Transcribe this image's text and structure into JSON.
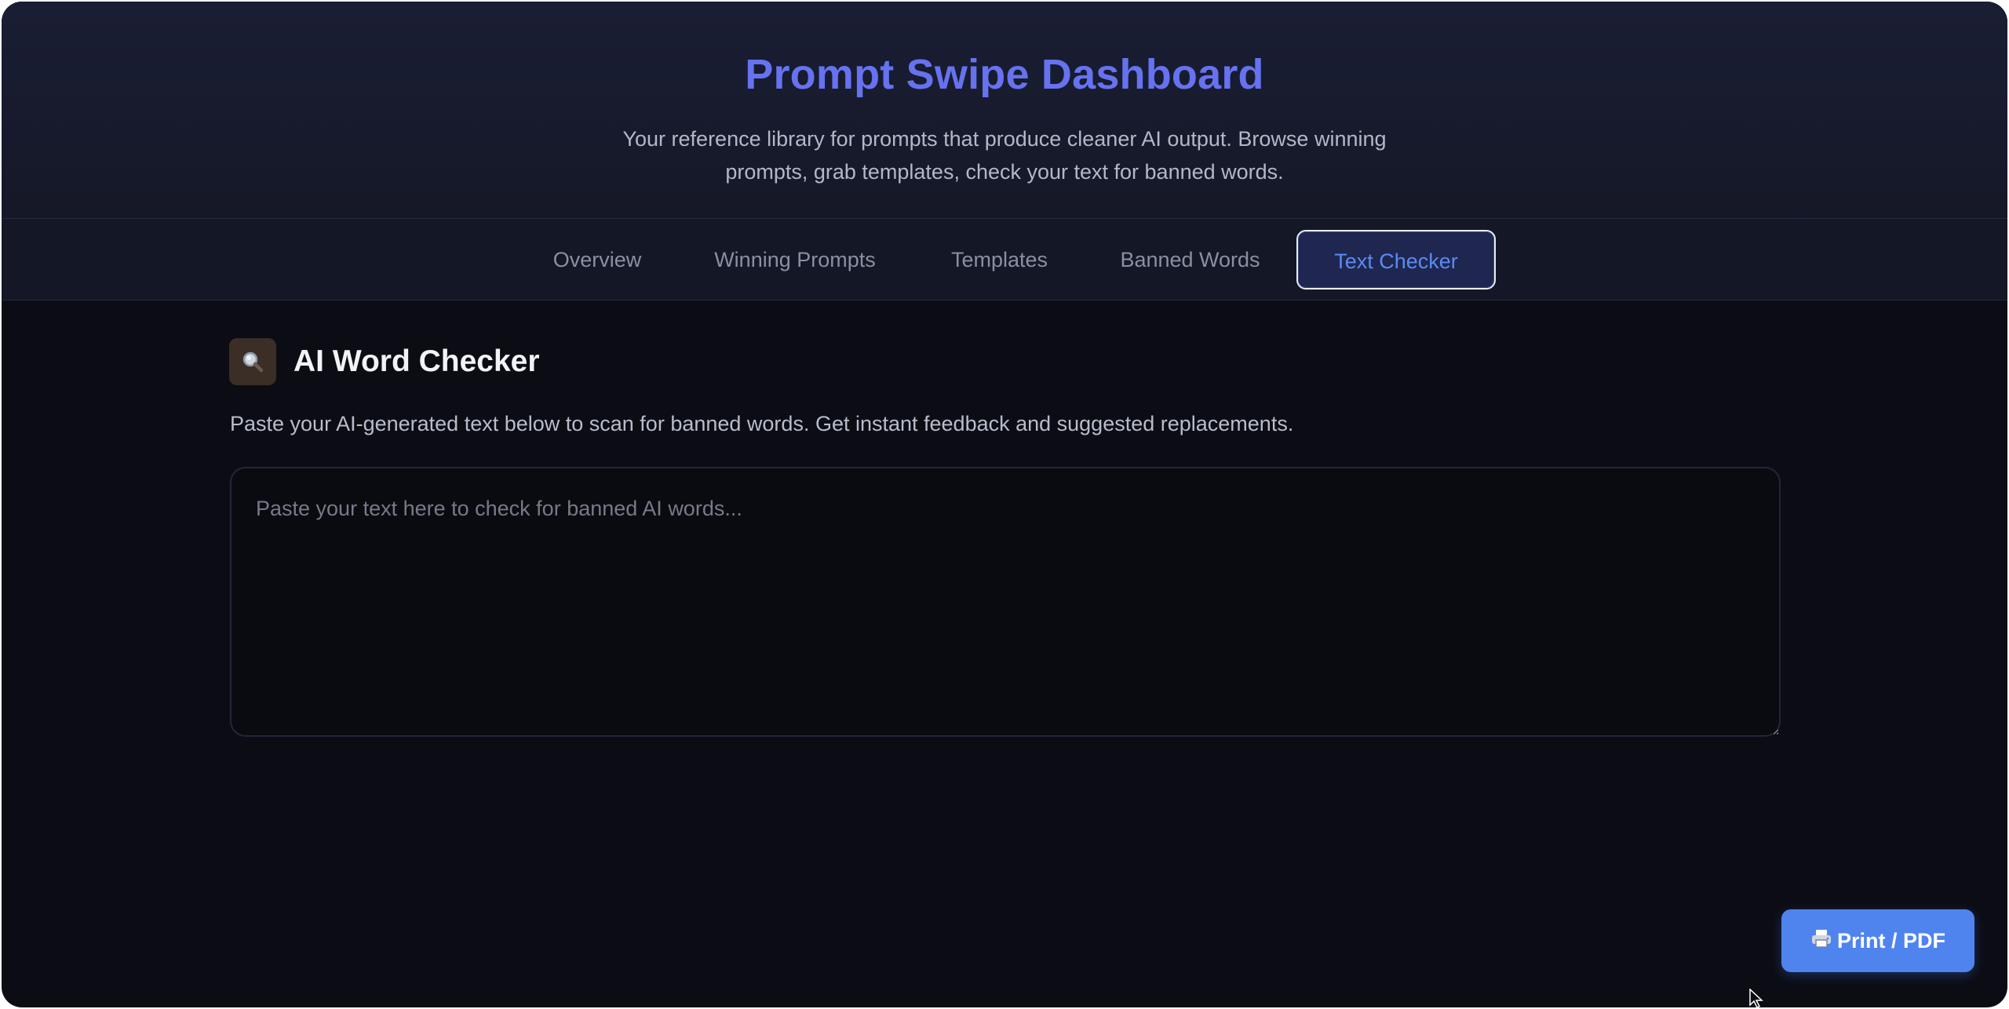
{
  "header": {
    "title": "Prompt Swipe Dashboard",
    "subtitle": "Your reference library for prompts that produce cleaner AI output. Browse winning prompts, grab templates, check your text for banned words."
  },
  "tabs": [
    {
      "label": "Overview",
      "active": false
    },
    {
      "label": "Winning Prompts",
      "active": false
    },
    {
      "label": "Templates",
      "active": false
    },
    {
      "label": "Banned Words",
      "active": false
    },
    {
      "label": "Text Checker",
      "active": true
    }
  ],
  "checker": {
    "icon": "search-icon",
    "title": "AI Word Checker",
    "description": "Paste your AI-generated text below to scan for banned words. Get instant feedback and suggested replacements.",
    "input_value": "",
    "placeholder": "Paste your text here to check for banned AI words..."
  },
  "print_button": {
    "icon": "printer-icon",
    "label": "Print / PDF"
  },
  "colors": {
    "accent": "#6672f0",
    "active_tab_text": "#5b8af3",
    "button_bg": "#4f84ef",
    "background": "#0c0d14"
  }
}
